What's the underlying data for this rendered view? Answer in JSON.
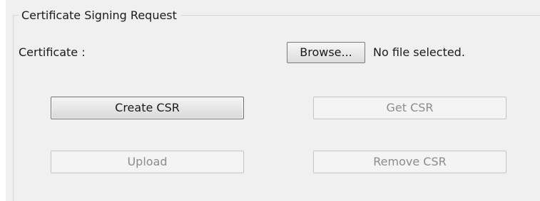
{
  "group": {
    "title": "Certificate Signing Request"
  },
  "certificate": {
    "label": "Certificate :",
    "browse_label": "Browse...",
    "file_status": "No file selected."
  },
  "buttons": {
    "create_csr": "Create CSR",
    "get_csr": "Get CSR",
    "upload": "Upload",
    "remove_csr": "Remove CSR"
  }
}
